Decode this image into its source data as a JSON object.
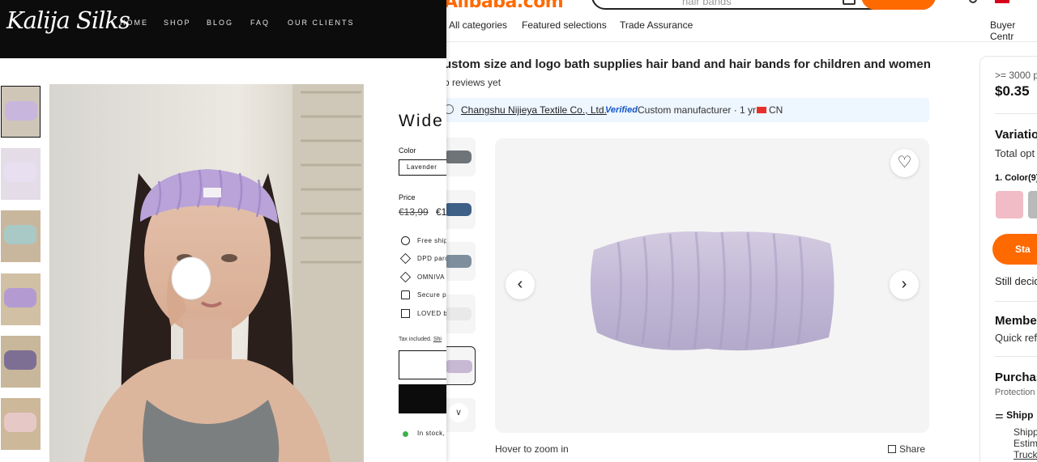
{
  "market": {
    "logo": "Alibaba.com",
    "search_placeholder": "hair bands",
    "nav": [
      "All categories",
      "Featured selections",
      "Trade Assurance",
      "Buyer Centr"
    ],
    "product_title": "ustom size and logo bath supplies hair band and hair bands for children and women",
    "reviews": "o reviews yet",
    "supplier": {
      "name": "Changshu Nijieya Textile Co., Ltd.",
      "separator": "·",
      "verified": "Verified",
      "details": "Custom manufacturer · 1 yr ·",
      "country": "CN"
    },
    "hover_hint": "Hover to zoom in",
    "share_label": "Share",
    "side": {
      "min_order": ">= 3000 p",
      "price": "$0.35",
      "variations_title": "Variatio",
      "total_options": "Total opt",
      "color_heading": "1. Color(9)",
      "start_order": "Sta",
      "still_deciding": "Still decid",
      "membership_title": "Member",
      "quick_ref": "Quick ref",
      "purchase_title": "Purchas",
      "protection": "Protection",
      "shipping": "Shipp",
      "ship_line1": "Shipp",
      "ship_line2": "Estim",
      "ship_line3": "Truck"
    },
    "thumb_colors": [
      "#6f7478",
      "#3e5f86",
      "#7e8e9d",
      "#e9e9e9",
      "#c7b8d4"
    ],
    "swatch_colors": [
      "#f2bcc6",
      "#b9b9b9"
    ],
    "accent": "#ff6a00"
  },
  "shop": {
    "logo": "Kalija Silks",
    "nav": [
      "HOME",
      "SHOP",
      "BLOG",
      "FAQ",
      "OUR CLIENTS"
    ],
    "product_title": "Wide c",
    "color_label": "Color",
    "color_value": "Lavender",
    "price_label": "Price",
    "price_old": "€13,99",
    "price_new": "€1",
    "features": [
      "Free ship",
      "DPD parc",
      "OMNIVA",
      "Secure p",
      "LOVED b"
    ],
    "tax_text": "Tax included.",
    "tax_link": "Shi",
    "stock": "In stock,",
    "thumb_colors": [
      "#c9b6dd",
      "#e8dff0",
      "#a9c9c6",
      "#b39bd1",
      "#7d6f94",
      "#e6c9c7"
    ]
  }
}
